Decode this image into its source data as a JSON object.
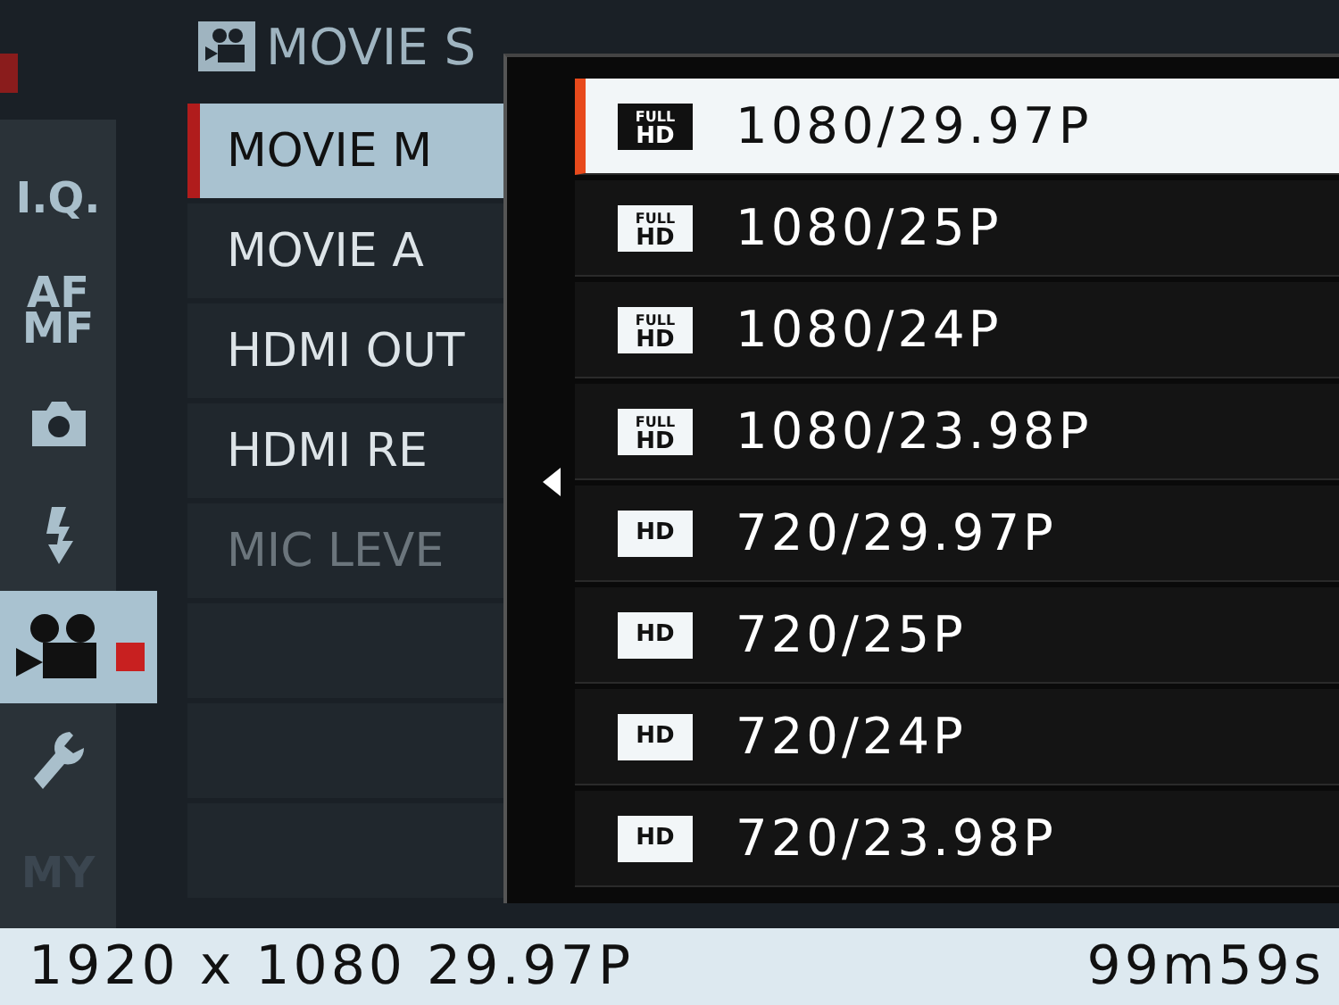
{
  "sidebar": {
    "items": [
      {
        "kind": "text",
        "lines": [
          "I.Q."
        ],
        "selected": false,
        "disabled": false
      },
      {
        "kind": "text",
        "lines": [
          "AF",
          "MF"
        ],
        "selected": false,
        "disabled": false
      },
      {
        "kind": "camera",
        "selected": false,
        "disabled": false
      },
      {
        "kind": "flash",
        "selected": false,
        "disabled": false
      },
      {
        "kind": "movie",
        "selected": true,
        "disabled": false
      },
      {
        "kind": "wrench",
        "selected": false,
        "disabled": false
      },
      {
        "kind": "text",
        "lines": [
          "MY"
        ],
        "selected": false,
        "disabled": true
      }
    ]
  },
  "menu": {
    "title": "MOVIE S",
    "items": [
      {
        "label": "MOVIE M",
        "selected": true,
        "disabled": false
      },
      {
        "label": "MOVIE A",
        "selected": false,
        "disabled": false
      },
      {
        "label": "HDMI OUT",
        "selected": false,
        "disabled": false
      },
      {
        "label": "HDMI RE",
        "selected": false,
        "disabled": false
      },
      {
        "label": "MIC LEVE",
        "selected": false,
        "disabled": true
      }
    ]
  },
  "popup": {
    "options": [
      {
        "badge": [
          "FULL",
          "HD"
        ],
        "label": "1080/29.97P",
        "selected": true
      },
      {
        "badge": [
          "FULL",
          "HD"
        ],
        "label": "1080/25P",
        "selected": false
      },
      {
        "badge": [
          "FULL",
          "HD"
        ],
        "label": "1080/24P",
        "selected": false
      },
      {
        "badge": [
          "FULL",
          "HD"
        ],
        "label": "1080/23.98P",
        "selected": false
      },
      {
        "badge": [
          "HD"
        ],
        "label": "720/29.97P",
        "selected": false
      },
      {
        "badge": [
          "HD"
        ],
        "label": "720/25P",
        "selected": false
      },
      {
        "badge": [
          "HD"
        ],
        "label": "720/24P",
        "selected": false
      },
      {
        "badge": [
          "HD"
        ],
        "label": "720/23.98P",
        "selected": false
      }
    ]
  },
  "status_bar": {
    "resolution": "1920 x 1080 29.97P",
    "remaining": "99m59s"
  }
}
